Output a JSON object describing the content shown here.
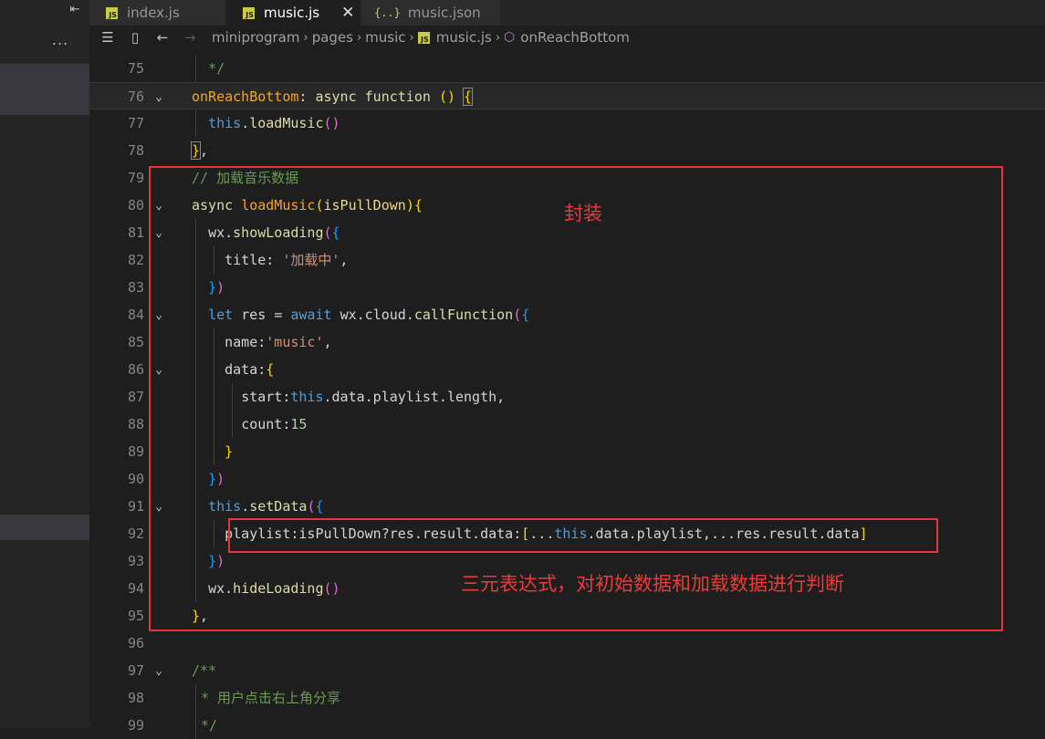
{
  "tabs": [
    {
      "name": "index.js",
      "type": "js"
    },
    {
      "name": "music.js",
      "type": "js",
      "active": true
    },
    {
      "name": "music.json",
      "type": "json"
    }
  ],
  "icons": {
    "js_badge": "JS",
    "json_badge": "{..}",
    "close": "✕",
    "more": "...",
    "collapse": "⇤"
  },
  "breadcrumb": [
    "miniprogram",
    "pages",
    "music",
    "music.js",
    "onReachBottom"
  ],
  "colors": {
    "annotation": "#e8353c",
    "editor_bg": "#1e1e1e"
  },
  "line_numbers": [
    "75",
    "76",
    "77",
    "78",
    "79",
    "80",
    "81",
    "82",
    "83",
    "84",
    "85",
    "86",
    "87",
    "88",
    "89",
    "90",
    "91",
    "92",
    "93",
    "94",
    "95",
    "96",
    "97",
    "98",
    "99"
  ],
  "code": {
    "l75": "*/",
    "l77_fn": "loadMusic",
    "l79": "// 加载音乐数据",
    "l80_fn": "loadMusic",
    "l80_param": "isPullDown",
    "l81_fn": "showLoading",
    "l82_key": "title",
    "l82_val": "'加载中'",
    "l84_var": "res",
    "l84_fn": "callFunction",
    "l85_key": "name",
    "l85_val": "'music'",
    "l86_key": "data",
    "l87_key": "start",
    "l88_key": "count",
    "l88_val": "15",
    "l91_fn": "setData",
    "l92_key": "playlist",
    "l94_fn": "hideLoading",
    "l97": "/**",
    "l98": "* 用户点击右上角分享",
    "l99": "*/"
  },
  "annotations": {
    "encapsulate": "封装",
    "ternary": "三元表达式，对初始数据和加载数据进行判断"
  }
}
